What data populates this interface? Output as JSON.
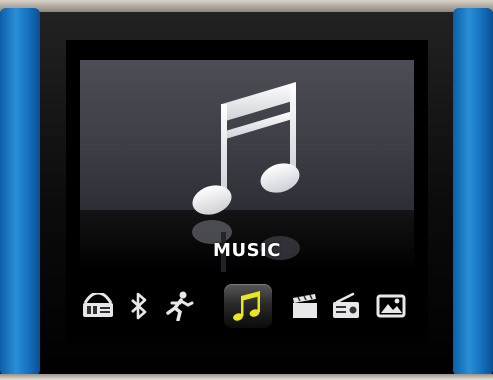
{
  "screen": {
    "title": "MUSIC",
    "accent": "#e8e81a",
    "background": "#45464e"
  },
  "menu": {
    "selected_index": 3,
    "items": [
      {
        "icon": "radio-fm-icon"
      },
      {
        "icon": "bluetooth-icon"
      },
      {
        "icon": "running-figure-icon"
      },
      {
        "icon": "music-note-icon"
      },
      {
        "icon": "video-clapper-icon"
      },
      {
        "icon": "radio-icon"
      },
      {
        "icon": "photo-icon"
      }
    ]
  }
}
